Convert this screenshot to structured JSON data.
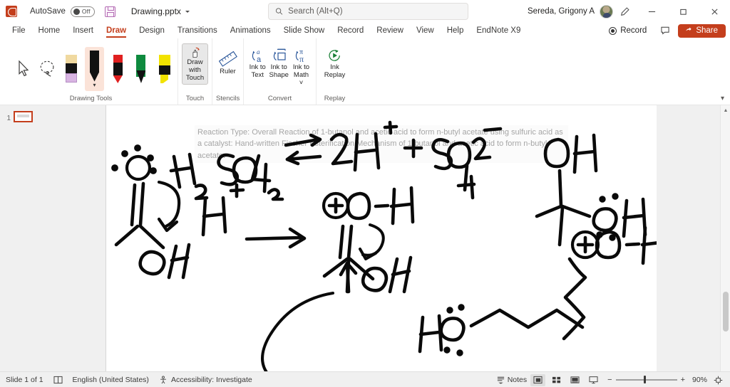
{
  "titlebar": {
    "app_icon": "powerpoint-logo",
    "autosave_label": "AutoSave",
    "autosave_state": "Off",
    "save_icon": "save-icon",
    "document_name": "Drawing.pptx",
    "account_name": "Sereda, Grigony A",
    "pen_icon": "pen-icon",
    "minimize_label": "–",
    "restore_label": "❐",
    "close_label": "✕"
  },
  "search": {
    "placeholder": "Search (Alt+Q)",
    "value": "",
    "icon": "search-icon"
  },
  "tabs": [
    {
      "label": "File",
      "active": false
    },
    {
      "label": "Home",
      "active": false
    },
    {
      "label": "Insert",
      "active": false
    },
    {
      "label": "Draw",
      "active": true
    },
    {
      "label": "Design",
      "active": false
    },
    {
      "label": "Transitions",
      "active": false
    },
    {
      "label": "Animations",
      "active": false
    },
    {
      "label": "Slide Show",
      "active": false
    },
    {
      "label": "Record",
      "active": false
    },
    {
      "label": "Review",
      "active": false
    },
    {
      "label": "View",
      "active": false
    },
    {
      "label": "Help",
      "active": false
    },
    {
      "label": "EndNote X9",
      "active": false
    }
  ],
  "tabs_right": {
    "record_label": "Record",
    "comment_icon": "comment-icon",
    "share_label": "Share",
    "share_icon": "share-icon",
    "share_color": "#c43e1c"
  },
  "ribbon": {
    "collapse_icon": "chevron-down-icon",
    "groups": [
      {
        "label": "Drawing Tools",
        "tools": [
          {
            "name": "select-tool",
            "label": "",
            "selected": false
          },
          {
            "name": "lasso-select-tool",
            "label": "",
            "selected": false
          },
          {
            "name": "eraser-tool",
            "label": "",
            "selected": false
          },
          {
            "name": "pen-black",
            "label": "",
            "selected": true,
            "color": "#111111"
          },
          {
            "name": "pen-red",
            "label": "",
            "selected": false,
            "color": "#e02020"
          },
          {
            "name": "pen-green",
            "label": "",
            "selected": false,
            "color": "#0e8a3e"
          },
          {
            "name": "highlighter-yellow",
            "label": "",
            "selected": false,
            "color": "#f2e200"
          }
        ]
      },
      {
        "label": "Touch",
        "buttons": [
          {
            "name": "draw-with-touch-button",
            "label": "Draw with Touch",
            "pressed": true
          }
        ]
      },
      {
        "label": "Stencils",
        "buttons": [
          {
            "name": "ruler-button",
            "label": "Ruler",
            "pressed": false
          }
        ]
      },
      {
        "label": "Convert",
        "buttons": [
          {
            "name": "ink-to-text-button",
            "label": "Ink to Text",
            "pressed": false
          },
          {
            "name": "ink-to-shape-button",
            "label": "Ink to Shape",
            "pressed": false
          },
          {
            "name": "ink-to-math-button",
            "label": "Ink to Math ˅",
            "pressed": false
          }
        ]
      },
      {
        "label": "Replay",
        "buttons": [
          {
            "name": "ink-replay-button",
            "label": "Ink Replay",
            "pressed": false
          }
        ]
      }
    ]
  },
  "thumbnails": {
    "slides": [
      {
        "number": "1",
        "selected": true
      }
    ]
  },
  "slide": {
    "textbox": "Reaction Type: Overall Reaction of 1-butanol and acetic acid to form n-butyl acetate using sulfuric acid as a catalyst: Hand-written Fischer Esterification Mechanism of 1-butanol and acetic acid to form n-butyl acetate:",
    "ink_description": "Hand-written Fischer esterification mechanism: H2SO4 equilibrium with 2H+ plus SO4 2-, acetic acid carbonyl attacked by H+, protonated carbonyl intermediate, 1-butanol HO attacking, tetrahedral intermediate with OH, OH and +O-H"
  },
  "statusbar": {
    "slide_counter": "Slide 1 of 1",
    "notes_page_icon": "notes-page-icon",
    "language": "English (United States)",
    "accessibility": "Accessibility: Investigate",
    "notes_label": "Notes",
    "views": [
      {
        "name": "normal-view-button",
        "active": true
      },
      {
        "name": "slide-sorter-view-button",
        "active": false
      },
      {
        "name": "reading-view-button",
        "active": false
      },
      {
        "name": "slide-show-button",
        "active": false
      }
    ],
    "zoom_out": "−",
    "zoom_in": "+",
    "zoom_level": "90%",
    "fit_slide_icon": "fit-to-window-icon"
  }
}
